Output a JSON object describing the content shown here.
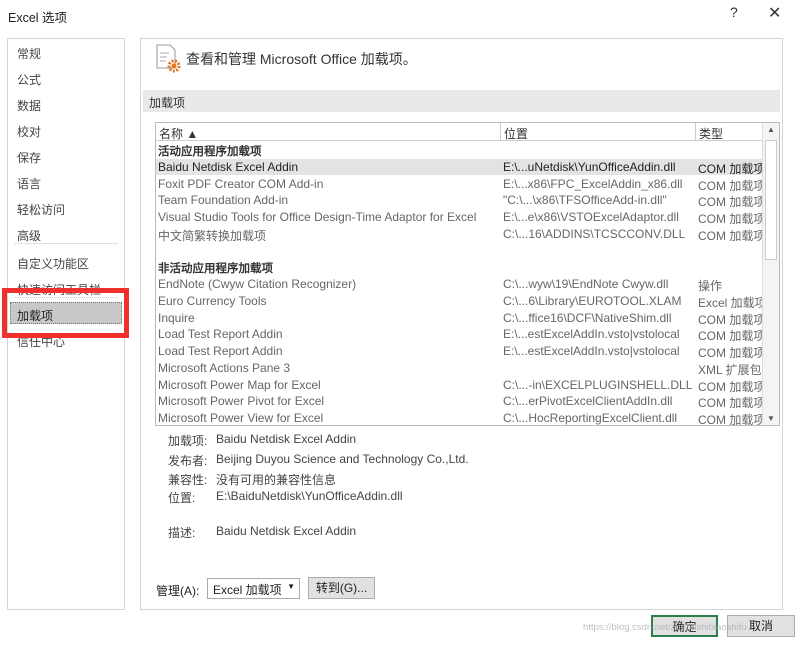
{
  "window": {
    "title": "Excel 选项",
    "help": "?",
    "close": "✕"
  },
  "sidebar": {
    "items": [
      "常规",
      "公式",
      "数据",
      "校对",
      "保存",
      "语言",
      "轻松访问",
      "高级",
      "自定义功能区",
      "快速访问工具栏",
      "加载项",
      "信任中心"
    ],
    "selected": "加载项"
  },
  "header": {
    "text": "查看和管理 Microsoft Office 加载项。",
    "icon": "addin-settings-icon"
  },
  "section": "加载项",
  "table": {
    "columns": [
      "名称 ▲",
      "位置",
      "类型"
    ],
    "group_active": "活动应用程序加载项",
    "active": [
      {
        "name": "Baidu Netdisk Excel Addin",
        "location": "E:\\...uNetdisk\\YunOfficeAddin.dll",
        "type": "COM 加载项"
      },
      {
        "name": "Foxit PDF Creator COM Add-in",
        "location": "E:\\...x86\\FPC_ExcelAddin_x86.dll",
        "type": "COM 加载项"
      },
      {
        "name": "Team Foundation Add-in",
        "location": "\"C:\\...\\x86\\TFSOfficeAdd-in.dll\"",
        "type": "COM 加载项"
      },
      {
        "name": "Visual Studio Tools for Office Design-Time Adaptor for Excel",
        "location": "E:\\...e\\x86\\VSTOExcelAdaptor.dll",
        "type": "COM 加载项"
      },
      {
        "name": "中文简繁转换加载项",
        "location": "C:\\...16\\ADDINS\\TCSCCONV.DLL",
        "type": "COM 加载项"
      }
    ],
    "group_inactive": "非活动应用程序加载项",
    "inactive": [
      {
        "name": "EndNote (Cwyw Citation Recognizer)",
        "location": "C:\\...wyw\\19\\EndNote Cwyw.dll",
        "type": "操作"
      },
      {
        "name": "Euro Currency Tools",
        "location": "C:\\...6\\Library\\EUROTOOL.XLAM",
        "type": "Excel 加载项"
      },
      {
        "name": "Inquire",
        "location": "C:\\...ffice16\\DCF\\NativeShim.dll",
        "type": "COM 加载项"
      },
      {
        "name": "Load Test Report Addin",
        "location": "E:\\...estExcelAddIn.vsto|vstolocal",
        "type": "COM 加载项"
      },
      {
        "name": "Load Test Report Addin",
        "location": "E:\\...estExcelAddIn.vsto|vstolocal",
        "type": "COM 加载项"
      },
      {
        "name": "Microsoft Actions Pane 3",
        "location": "",
        "type": "XML 扩展包"
      },
      {
        "name": "Microsoft Power Map for Excel",
        "location": "C:\\...-in\\EXCELPLUGINSHELL.DLL",
        "type": "COM 加载项"
      },
      {
        "name": "Microsoft Power Pivot for Excel",
        "location": "C:\\...erPivotExcelClientAddIn.dll",
        "type": "COM 加载项"
      },
      {
        "name": "Microsoft Power View for Excel",
        "location": "C:\\...HocReportingExcelClient.dll",
        "type": "COM 加载项"
      }
    ]
  },
  "details": {
    "addin_label": "加载项:",
    "addin": "Baidu Netdisk Excel Addin",
    "publisher_label": "发布者:",
    "publisher": "Beijing Duyou Science and Technology Co.,Ltd.",
    "compat_label": "兼容性:",
    "compat": "没有可用的兼容性信息",
    "location_label": "位置:",
    "location": "E:\\BaiduNetdisk\\YunOfficeAddin.dll",
    "desc_label": "描述:",
    "desc": "Baidu Netdisk Excel Addin"
  },
  "manage": {
    "label": "管理(A):",
    "value": "Excel 加载项",
    "go": "转到(G)..."
  },
  "footer": {
    "ok": "确定",
    "cancel": "取消"
  },
  "watermark": "https://blog.csdn.net/zhebushibiaoshifu"
}
